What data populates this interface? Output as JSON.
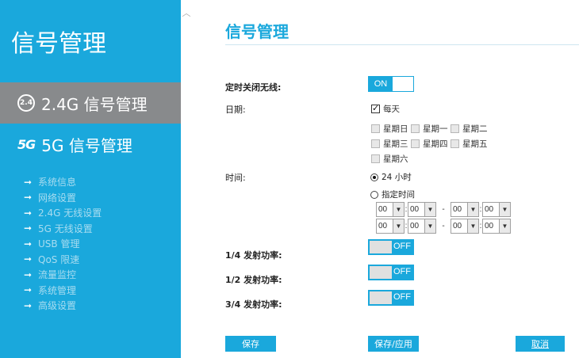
{
  "sidebar": {
    "title": "信号管理",
    "items": [
      {
        "label": "2.4G 信号管理",
        "icon": "2.4g-icon",
        "icon_text": "2.4"
      },
      {
        "label": "5G 信号管理",
        "icon": "5g-icon",
        "icon_text": "5G"
      }
    ],
    "sub_items": [
      "系统信息",
      "网络设置",
      "2.4G 无线设置",
      "5G 无线设置",
      "USB 管理",
      "QoS 限速",
      "流量监控",
      "系统管理",
      "高级设置"
    ]
  },
  "main": {
    "title": "信号管理",
    "scheduled_off_label": "定时关闭无线:",
    "scheduled_off_toggle": "ON",
    "date_label": "日期:",
    "everyday_label": "每天",
    "weekdays": [
      "星期日",
      "星期一",
      "星期二",
      "星期三",
      "星期四",
      "星期五",
      "星期六"
    ],
    "time_label": "时间:",
    "radio_24h": "24 小时",
    "radio_custom": "指定时间",
    "time_rows": [
      {
        "h1": "00",
        "m1": "00",
        "h2": "00",
        "m2": "00"
      },
      {
        "h1": "00",
        "m1": "00",
        "h2": "00",
        "m2": "00"
      }
    ],
    "power_quarter_label": "1/4 发射功率:",
    "power_half_label": "1/2 发射功率:",
    "power_three_quarter_label": "3/4 发射功率:",
    "toggle_off_text": "OFF"
  },
  "buttons": {
    "save": "保存",
    "save_apply": "保存/应用",
    "cancel": "取消"
  },
  "colors": {
    "accent": "#1aa8dc",
    "sidebar_active": "#888a8c"
  }
}
